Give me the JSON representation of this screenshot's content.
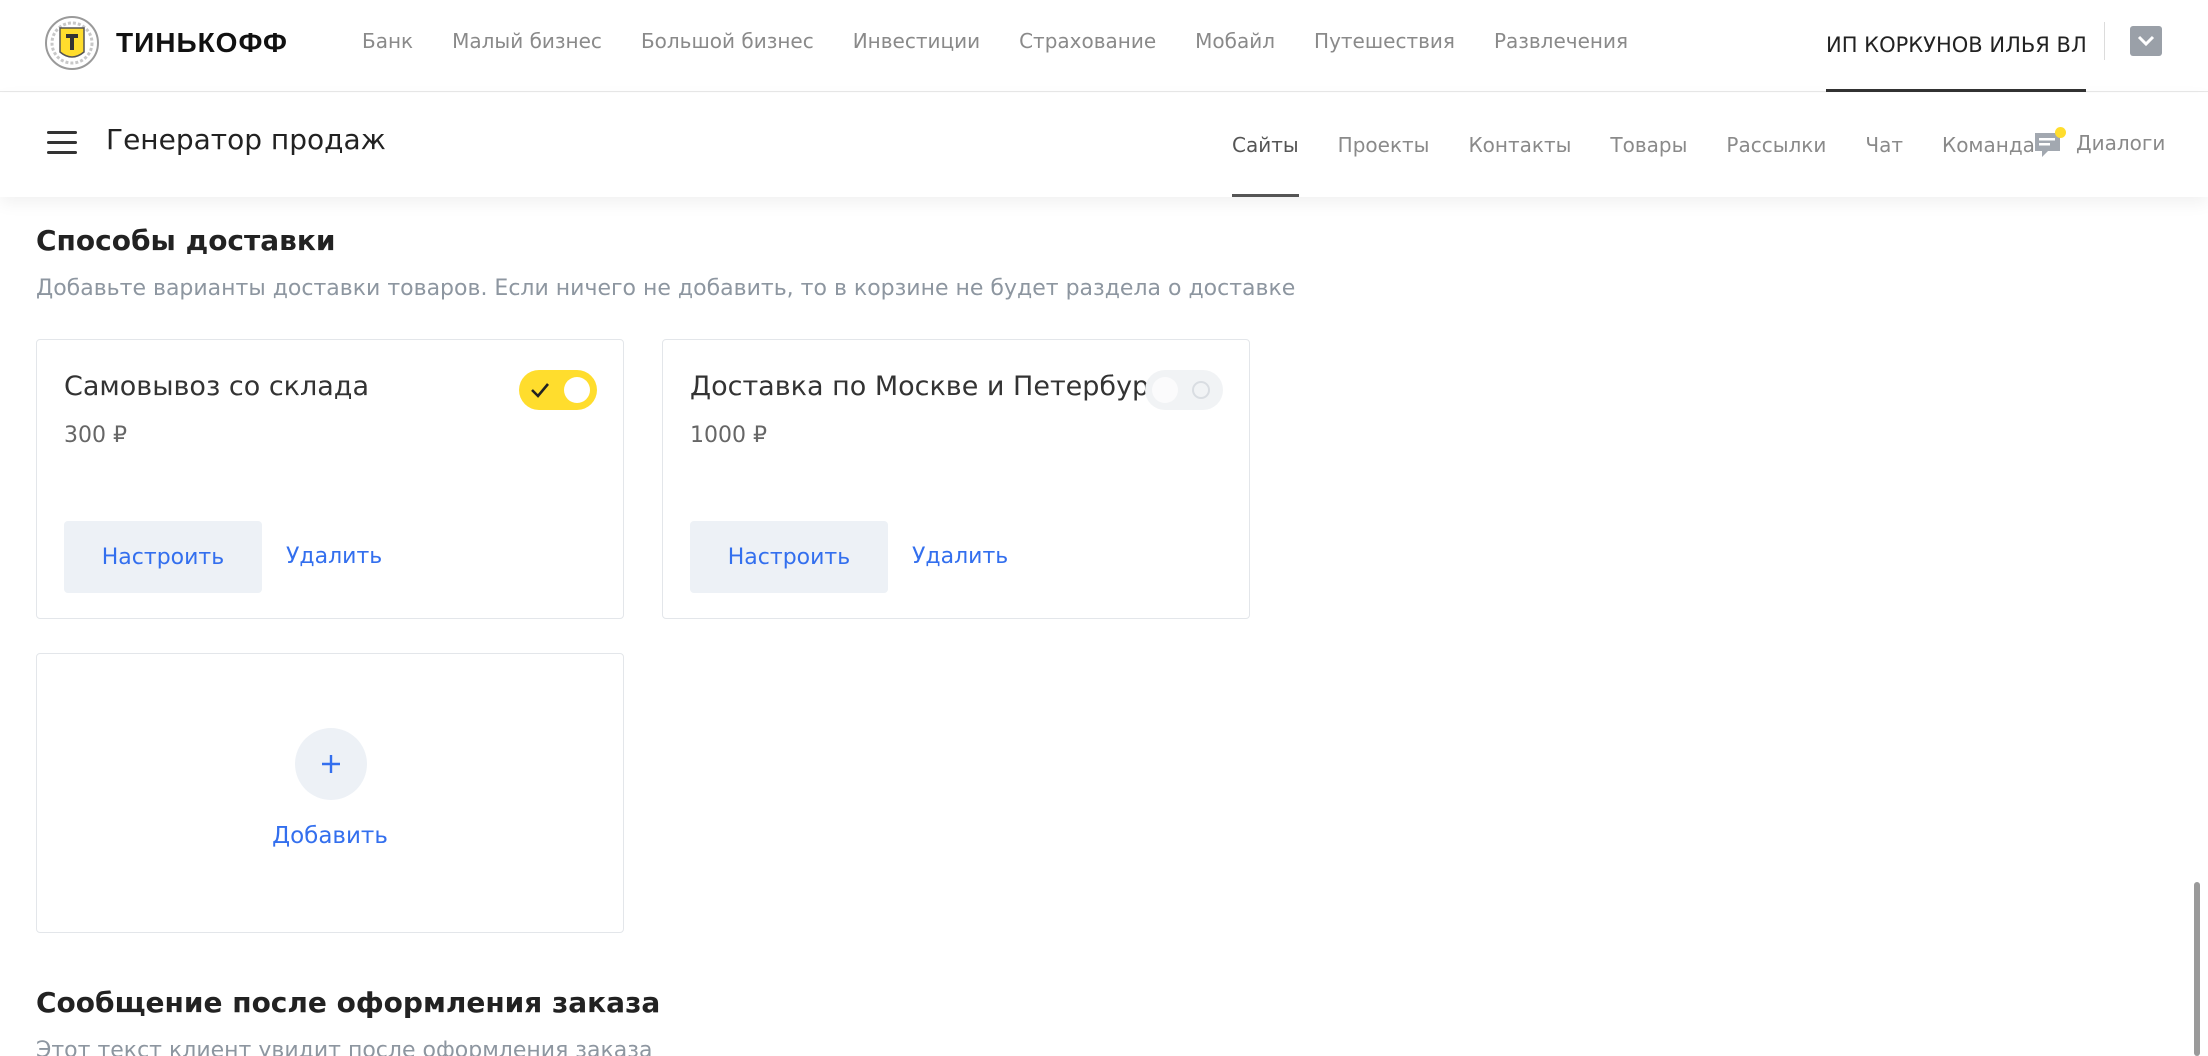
{
  "brand": {
    "name": "ТИНЬКОФФ"
  },
  "top_nav": {
    "items": [
      "Банк",
      "Малый бизнес",
      "Большой бизнес",
      "Инвестиции",
      "Страхование",
      "Мобайл",
      "Путешествия",
      "Развлечения"
    ]
  },
  "account": {
    "name": "ИП КОРКУНОВ ИЛЬЯ ВЛ..."
  },
  "subbar": {
    "title": "Генератор продаж",
    "nav": [
      "Сайты",
      "Проекты",
      "Контакты",
      "Товары",
      "Рассылки",
      "Чат",
      "Команда"
    ],
    "active": "Сайты",
    "dialogs_label": "Диалоги"
  },
  "delivery": {
    "title": "Способы доставки",
    "description": "Добавьте варианты доставки товаров. Если ничего не добавить, то в корзине не будет раздела о доставке",
    "methods": [
      {
        "title": "Самовывоз со склада",
        "price": "300 ₽",
        "enabled": true,
        "configure_label": "Настроить",
        "delete_label": "Удалить"
      },
      {
        "title": "Доставка по Москве и Петербургу",
        "price": "1000 ₽",
        "enabled": false,
        "configure_label": "Настроить",
        "delete_label": "Удалить"
      }
    ],
    "add_label": "Добавить"
  },
  "order_message": {
    "title": "Сообщение после оформления заказа",
    "description": "Этот текст клиент увидит после оформления заказа"
  },
  "colors": {
    "accent": "#ffdd2d",
    "link": "#336fee",
    "button_bg": "#edf1f6",
    "muted_text": "#8d96a0"
  },
  "icons": {
    "logo": "tinkoff-emblem-icon",
    "menu": "hamburger-menu-icon",
    "dialogs": "chat-bubble-icon",
    "account_toggle": "chevron-down-icon",
    "toggle_on": "checkmark-icon",
    "add": "plus-icon"
  }
}
